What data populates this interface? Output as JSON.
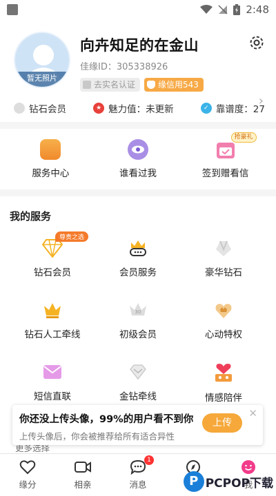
{
  "status_bar": {
    "time": "2:48"
  },
  "profile": {
    "avatar_label": "暂无照片",
    "nickname": "向卉知足的在金山",
    "user_id": "佳缘ID：305338926",
    "verify_badge": "去实名认证",
    "credit_badge": "缘信用543",
    "stats": {
      "diamond": "钻石会员",
      "charm": "魅力值：未更新",
      "reliability": "靠谱度：27"
    }
  },
  "quick_actions": [
    {
      "label": "服务中心"
    },
    {
      "label": "谁看过我"
    },
    {
      "label": "签到赠看信",
      "tag": "抢豪礼"
    }
  ],
  "services": {
    "title": "我的服务",
    "items": [
      {
        "label": "钻石会员",
        "tag": "尊贵之选"
      },
      {
        "label": "会员服务"
      },
      {
        "label": "豪华钻石"
      },
      {
        "label": "钻石人工牵线"
      },
      {
        "label": "初级会员"
      },
      {
        "label": "心动特权"
      },
      {
        "label": "短信直联"
      },
      {
        "label": "金钻牵线"
      },
      {
        "label": "情感陪伴"
      }
    ]
  },
  "upload_prompt": {
    "title": "你还没上传头像，99%的用户看不到你",
    "subtitle": "上传头像后，你会被推荐给所有适合异性",
    "button": "上传",
    "more": "更多选择"
  },
  "tabbar": [
    {
      "label": "缘分"
    },
    {
      "label": "相亲"
    },
    {
      "label": "消息",
      "badge": "1"
    },
    {
      "label": "发"
    },
    {
      "label": "我"
    }
  ],
  "watermark": {
    "text": "PCPOP下载"
  },
  "colors": {
    "accent": "#f6a83a",
    "credit": "#f7a945",
    "tag": "#f47a2a"
  }
}
